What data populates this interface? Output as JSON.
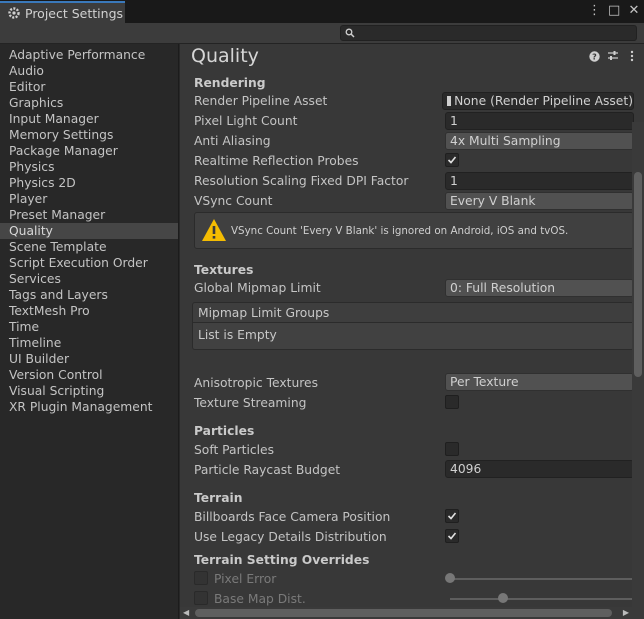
{
  "window": {
    "tab_title": "Project Settings",
    "controls": [
      "⋮",
      "□",
      "✕"
    ]
  },
  "search": {
    "placeholder": ""
  },
  "sidebar": {
    "items": [
      "Adaptive Performance",
      "Audio",
      "Editor",
      "Graphics",
      "Input Manager",
      "Memory Settings",
      "Package Manager",
      "Physics",
      "Physics 2D",
      "Player",
      "Preset Manager",
      "Quality",
      "Scene Template",
      "Script Execution Order",
      "Services",
      "Tags and Layers",
      "TextMesh Pro",
      "Time",
      "Timeline",
      "UI Builder",
      "Version Control",
      "Visual Scripting",
      "XR Plugin Management"
    ],
    "selected": "Quality"
  },
  "main": {
    "title": "Quality",
    "rendering": {
      "header": "Rendering",
      "render_pipeline_label": "Render Pipeline Asset",
      "render_pipeline_value": "None (Render Pipeline Asset)",
      "pixel_light_label": "Pixel Light Count",
      "pixel_light_value": "1",
      "anti_aliasing_label": "Anti Aliasing",
      "anti_aliasing_value": "4x Multi Sampling",
      "realtime_reflection_label": "Realtime Reflection Probes",
      "realtime_reflection_checked": true,
      "resolution_scaling_label": "Resolution Scaling Fixed DPI Factor",
      "resolution_scaling_value": "1",
      "vsync_label": "VSync Count",
      "vsync_value": "Every V Blank",
      "vsync_warning": "VSync Count 'Every V Blank' is ignored on Android, iOS and tvOS."
    },
    "textures": {
      "header": "Textures",
      "mipmap_label": "Global Mipmap Limit",
      "mipmap_value": "0: Full Resolution",
      "mipmap_groups_header": "Mipmap Limit Groups",
      "mipmap_groups_empty": "List is Empty",
      "anisotropic_label": "Anisotropic Textures",
      "anisotropic_value": "Per Texture",
      "streaming_label": "Texture Streaming",
      "streaming_checked": false
    },
    "particles": {
      "header": "Particles",
      "soft_label": "Soft Particles",
      "soft_checked": false,
      "raycast_label": "Particle Raycast Budget",
      "raycast_value": "4096"
    },
    "terrain": {
      "header": "Terrain",
      "billboards_label": "Billboards Face Camera Position",
      "billboards_checked": true,
      "legacy_label": "Use Legacy Details Distribution",
      "legacy_checked": true
    },
    "terrain_overrides": {
      "header": "Terrain Setting Overrides",
      "pixel_error_label": "Pixel Error",
      "base_map_label": "Base Map Dist."
    }
  }
}
